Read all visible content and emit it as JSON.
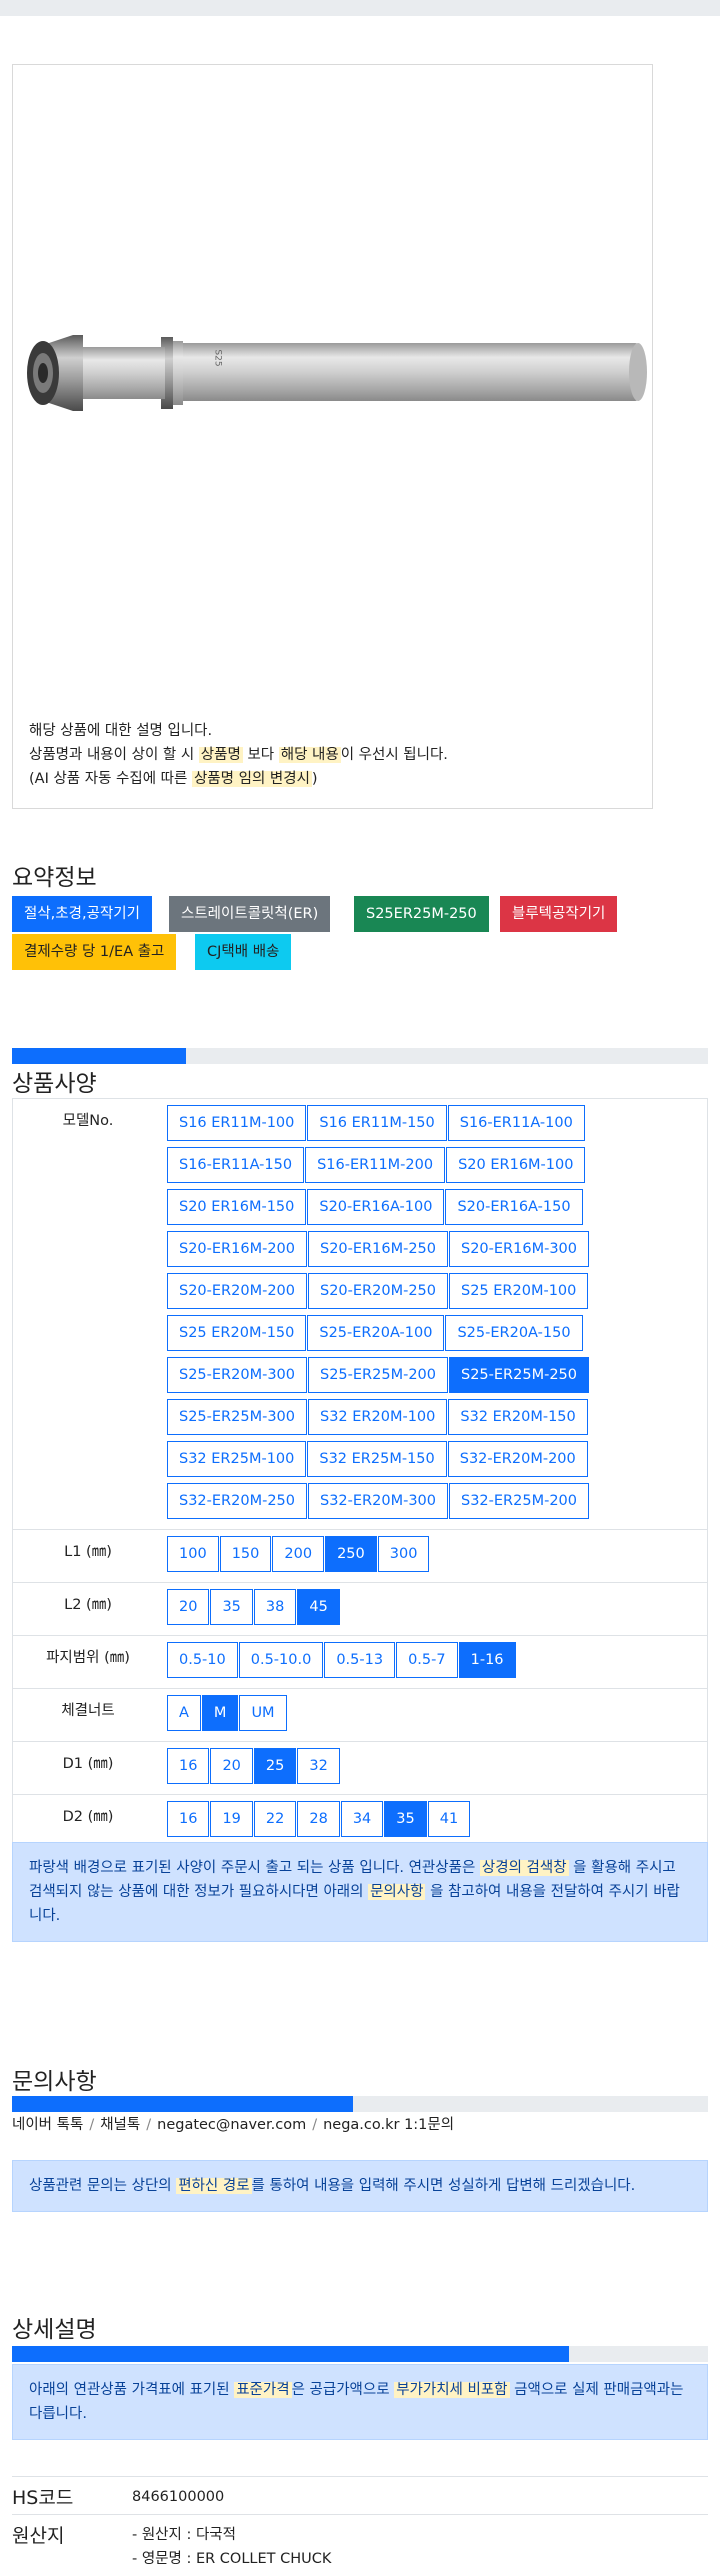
{
  "product": {
    "image_desc": {
      "line1": "해당 상품에 대한 설명 입니다.",
      "line2_a": "상품명과 내용이 상이 할 시",
      "line2_hl1": "상품명",
      "line2_b": "보다",
      "line2_hl2": "해당 내용",
      "line2_c": "이 우선시 됩니다.",
      "line3_a": "(AI 상품 자동 수집에 따른",
      "line3_hl": "상품명 임의 변경시",
      "line3_b": ")"
    },
    "engraving": "S25"
  },
  "summary": {
    "title": "요약정보",
    "badges": [
      "절삭,초경,공작기기",
      "스트레이트콜릿척(ER)",
      "S25ER25M-250",
      "블루텍공작기기",
      "결제수량 당 1/EA 출고",
      "CJ택배 배송"
    ],
    "colors": [
      "#0d6efd",
      "#6c757d",
      "#198754",
      "#dc3545",
      "#ffc107",
      "#0dcaf0"
    ]
  },
  "spec": {
    "title": "상품사양",
    "progress_percent": 25,
    "rows": [
      {
        "label": "모델No.",
        "options": [
          "S16 ER11M-100",
          "S16 ER11M-150",
          "S16-ER11A-100",
          "S16-ER11A-150",
          "S16-ER11M-200",
          "S20 ER16M-100",
          "S20 ER16M-150",
          "S20-ER16A-100",
          "S20-ER16A-150",
          "S20-ER16M-200",
          "S20-ER16M-250",
          "S20-ER16M-300",
          "S20-ER20M-200",
          "S20-ER20M-250",
          "S25 ER20M-100",
          "S25 ER20M-150",
          "S25-ER20A-100",
          "S25-ER20A-150",
          "S25-ER20M-300",
          "S25-ER25M-200",
          "S25-ER25M-250",
          "S25-ER25M-300",
          "S32 ER20M-100",
          "S32 ER20M-150",
          "S32 ER25M-100",
          "S32 ER25M-150",
          "S32-ER20M-200",
          "S32-ER20M-250",
          "S32-ER20M-300",
          "S32-ER25M-200"
        ],
        "selected": "S25-ER25M-250"
      },
      {
        "label": "L1 (㎜)",
        "options": [
          "100",
          "150",
          "200",
          "250",
          "300"
        ],
        "selected": "250"
      },
      {
        "label": "L2 (㎜)",
        "options": [
          "20",
          "35",
          "38",
          "45"
        ],
        "selected": "45"
      },
      {
        "label": "파지범위 (㎜)",
        "options": [
          "0.5-10",
          "0.5-10.0",
          "0.5-13",
          "0.5-7",
          "1-16"
        ],
        "selected": "1-16"
      },
      {
        "label": "체결너트",
        "options": [
          "A",
          "M",
          "UM"
        ],
        "selected": "M"
      },
      {
        "label": "D1 (㎜)",
        "options": [
          "16",
          "20",
          "25",
          "32"
        ],
        "selected": "25"
      },
      {
        "label": "D2 (㎜)",
        "options": [
          "16",
          "19",
          "22",
          "28",
          "34",
          "35",
          "41"
        ],
        "selected": "35"
      }
    ],
    "notice_a": "파랑색 배경으로 표기된 사양이 주문시 출고 되는 상품 입니다. 연관상품은",
    "notice_hl1": "상경의 검색창",
    "notice_b": "을 활용해 주시고 검색되지 않는 상품에 대한 정보가 필요하시다면 아래의",
    "notice_hl2": "문의사항",
    "notice_c": "을 참고하여 내용을 전달하여 주시기 바랍니다."
  },
  "inquiry": {
    "title": "문의사항",
    "progress_percent": 49,
    "channels": [
      "네이버 톡톡",
      "채널톡",
      "negatec@naver.com",
      "nega.co.kr 1:1문의"
    ],
    "notice_a": "상품관련 문의는 상단의",
    "notice_hl": "편하신 경로",
    "notice_b": "를 통하여 내용을 입력해 주시면 성실하게 답변해 드리겠습니다."
  },
  "detail": {
    "title": "상세설명",
    "progress_percent": 80,
    "notice_a": "아래의 연관상품 가격표에 표기된",
    "notice_hl1": "표준가격",
    "notice_b": "은 공급가액으로",
    "notice_hl2": "부가가치세 비포함",
    "notice_c": "금액으로 실제 판매금액과는 다릅니다.",
    "hs_label": "HS코드",
    "hs_value": "8466100000",
    "origin_label": "원산지",
    "origin_line1": "- 원산지 : 다국적",
    "origin_line2": "- 영문명 : ER COLLET CHUCK"
  }
}
